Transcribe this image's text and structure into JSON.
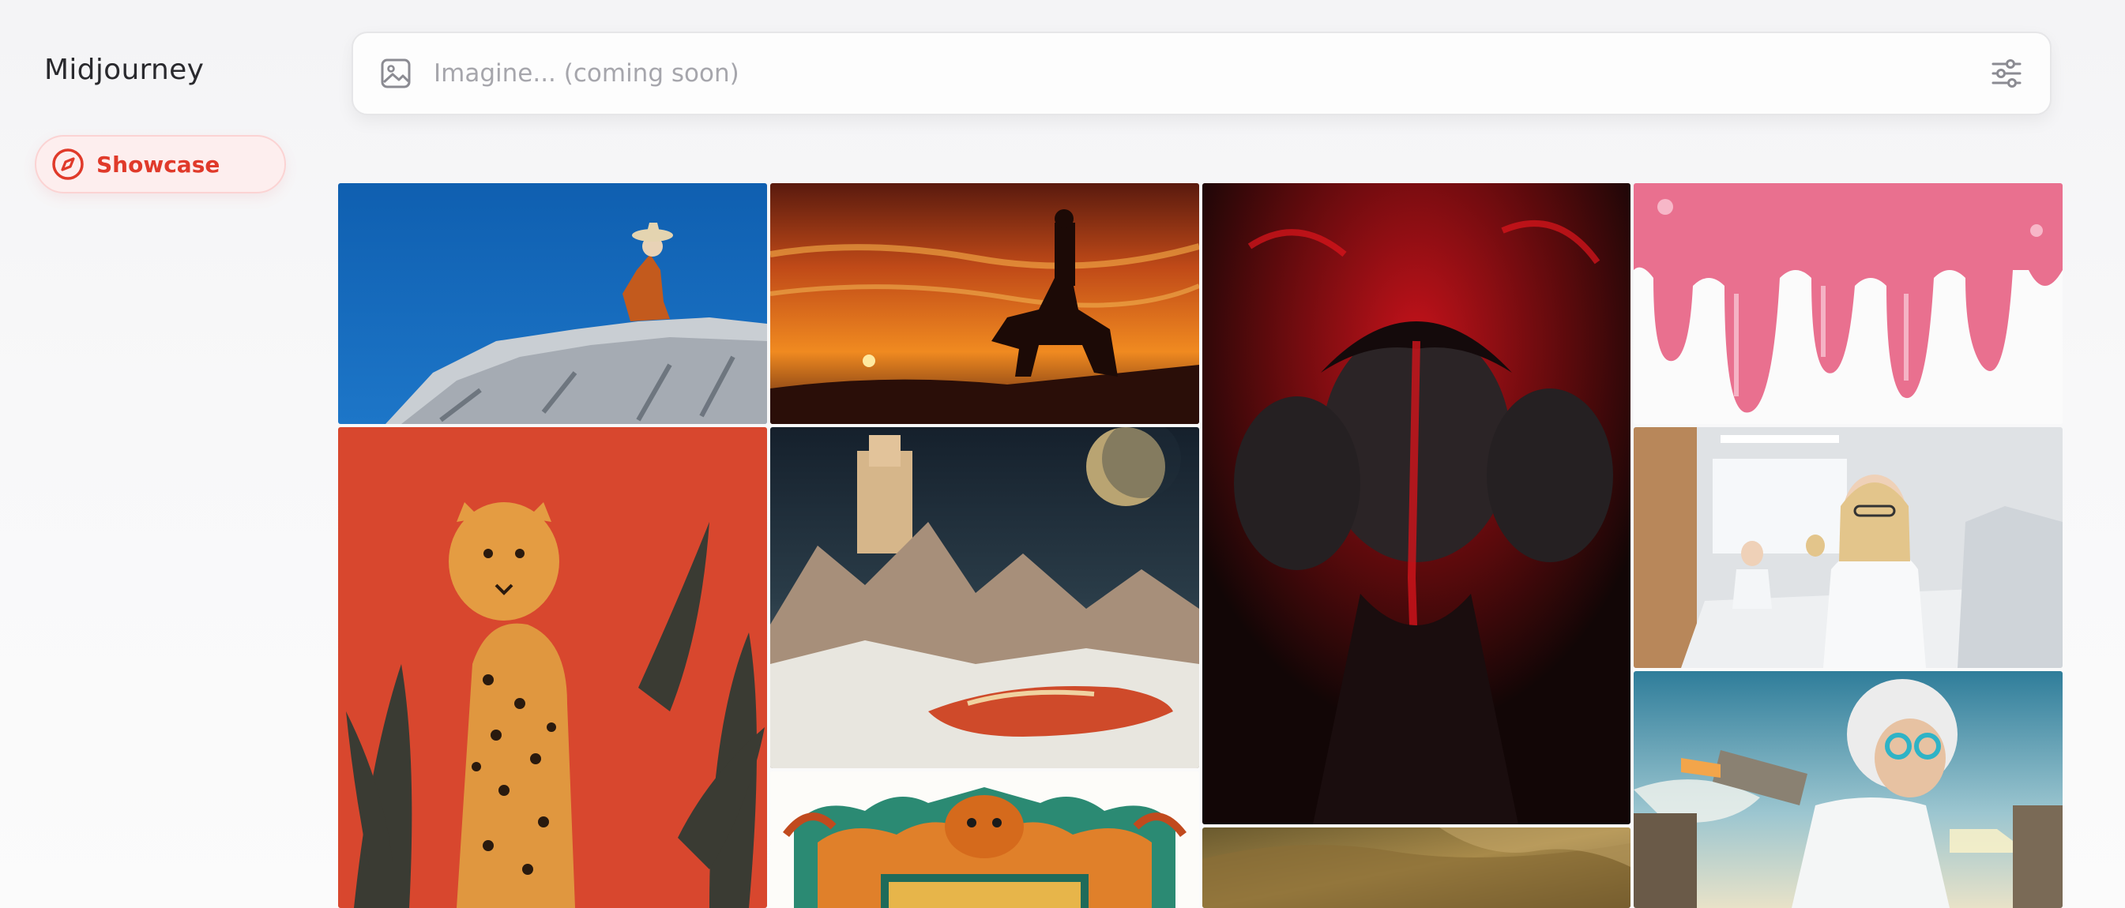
{
  "app": {
    "name": "Midjourney"
  },
  "sidebar": {
    "items": [
      {
        "label": "Showcase",
        "icon": "compass-icon",
        "active": true
      }
    ]
  },
  "search": {
    "placeholder": "Imagine... (coming soon)",
    "value": "",
    "left_icon": "image-icon",
    "right_icon": "sliders-icon"
  },
  "colors": {
    "accent": "#e03a2a",
    "accent_bg": "#fdeeee"
  },
  "gallery": {
    "images": [
      {
        "name": "monk-on-rock"
      },
      {
        "name": "horseman-sunset"
      },
      {
        "name": "red-dark-faces"
      },
      {
        "name": "pink-drips"
      },
      {
        "name": "cheetah-poster"
      },
      {
        "name": "retro-space-car"
      },
      {
        "name": "scientist-lab"
      },
      {
        "name": "dragon-ornament"
      },
      {
        "name": "rocky-terrain"
      },
      {
        "name": "jetpack-grandma"
      }
    ]
  }
}
